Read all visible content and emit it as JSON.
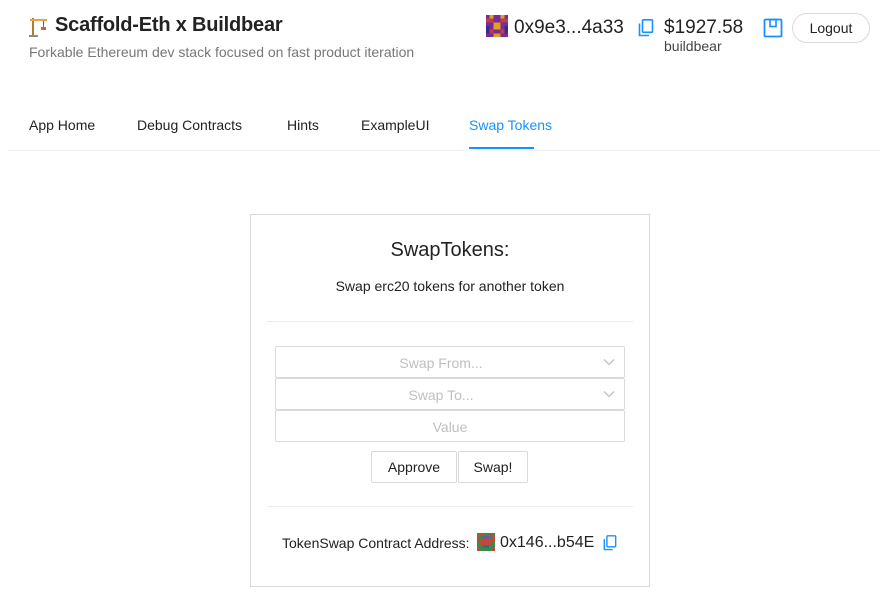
{
  "header": {
    "logo_icon": "construction-crane-icon",
    "title": "Scaffold-Eth x Buildbear",
    "subtitle": "Forkable Ethereum dev stack focused on fast product iteration",
    "account": {
      "address": "0x9e3...4a33",
      "balance": "$1927.58",
      "network": "buildbear",
      "copy_icon": "copy-icon",
      "wallet_icon": "wallet-icon"
    },
    "logout_label": "Logout"
  },
  "nav": {
    "tabs": [
      {
        "label": "App Home",
        "active": false
      },
      {
        "label": "Debug Contracts",
        "active": false
      },
      {
        "label": "Hints",
        "active": false
      },
      {
        "label": "ExampleUI",
        "active": false
      },
      {
        "label": "Swap Tokens",
        "active": true
      }
    ]
  },
  "swap": {
    "title": "SwapTokens:",
    "description": "Swap erc20 tokens for another token",
    "from_placeholder": "Swap From...",
    "to_placeholder": "Swap To...",
    "value_placeholder": "Value",
    "approve_label": "Approve",
    "swap_label": "Swap!",
    "contract_label": "TokenSwap Contract Address:",
    "contract_address": "0x146...b54E"
  },
  "colors": {
    "accent": "#1890ff",
    "border": "#d9d9d9",
    "placeholder": "#bfbfbf",
    "subtitle": "#777777"
  }
}
